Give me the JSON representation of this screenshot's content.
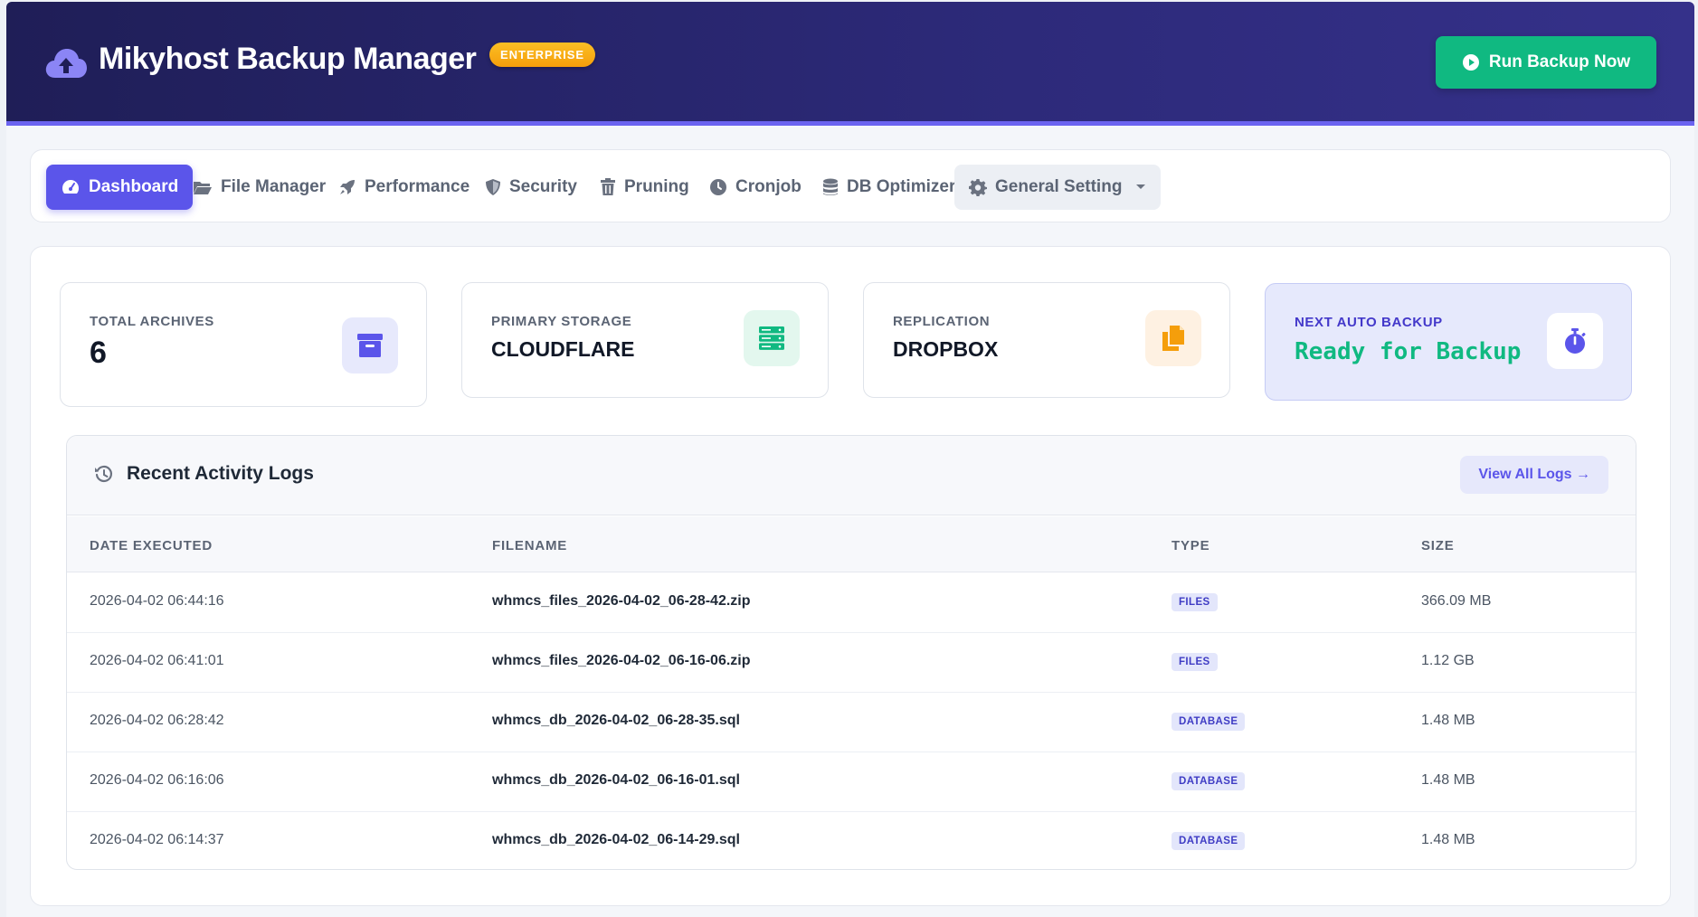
{
  "header": {
    "title": "Mikyhost Backup Manager",
    "badge": "ENTERPRISE",
    "run_button": "Run Backup Now"
  },
  "nav": {
    "items": [
      {
        "label": "Dashboard",
        "icon": "gauge-icon",
        "active": true
      },
      {
        "label": "File Manager",
        "icon": "folder-open-icon"
      },
      {
        "label": "Performance",
        "icon": "rocket-icon"
      },
      {
        "label": "Security",
        "icon": "shield-icon"
      },
      {
        "label": "Pruning",
        "icon": "trash-icon"
      },
      {
        "label": "Cronjob",
        "icon": "clock-icon"
      },
      {
        "label": "DB Optimizer",
        "icon": "database-icon"
      },
      {
        "label": "General Setting",
        "icon": "gear-icon",
        "dropdown": true
      }
    ]
  },
  "stats": [
    {
      "label": "TOTAL ARCHIVES",
      "value": "6",
      "icon": "archive-box-icon"
    },
    {
      "label": "PRIMARY STORAGE",
      "value": "CLOUDFLARE",
      "icon": "server-icon"
    },
    {
      "label": "REPLICATION",
      "value": "DROPBOX",
      "icon": "copy-icon"
    },
    {
      "label": "NEXT AUTO BACKUP",
      "value": "Ready for Backup",
      "icon": "stopwatch-icon"
    }
  ],
  "logs": {
    "title": "Recent Activity Logs",
    "view_all": "View All Logs →",
    "columns": [
      "DATE EXECUTED",
      "FILENAME",
      "TYPE",
      "SIZE"
    ],
    "rows": [
      {
        "date": "2026-04-02 06:44:16",
        "file": "whmcs_files_2026-04-02_06-28-42.zip",
        "type": "FILES",
        "size": "366.09 MB"
      },
      {
        "date": "2026-04-02 06:41:01",
        "file": "whmcs_files_2026-04-02_06-16-06.zip",
        "type": "FILES",
        "size": "1.12 GB"
      },
      {
        "date": "2026-04-02 06:28:42",
        "file": "whmcs_db_2026-04-02_06-28-35.sql",
        "type": "DATABASE",
        "size": "1.48 MB"
      },
      {
        "date": "2026-04-02 06:16:06",
        "file": "whmcs_db_2026-04-02_06-16-01.sql",
        "type": "DATABASE",
        "size": "1.48 MB"
      },
      {
        "date": "2026-04-02 06:14:37",
        "file": "whmcs_db_2026-04-02_06-14-29.sql",
        "type": "DATABASE",
        "size": "1.48 MB"
      }
    ]
  },
  "colors": {
    "header_bg": "#1f1e57",
    "accent": "#5b55ea",
    "success": "#10b981",
    "badge": "#f59e0b"
  }
}
